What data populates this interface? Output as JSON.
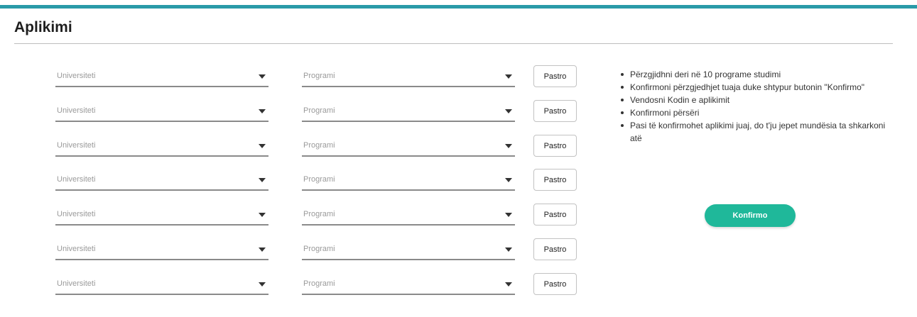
{
  "header": {
    "title": "Aplikimi",
    "accent_color": "#2a9aa8"
  },
  "rows": [
    {
      "university_placeholder": "Universiteti",
      "program_placeholder": "Programi",
      "clear_label": "Pastro"
    },
    {
      "university_placeholder": "Universiteti",
      "program_placeholder": "Programi",
      "clear_label": "Pastro"
    },
    {
      "university_placeholder": "Universiteti",
      "program_placeholder": "Programi",
      "clear_label": "Pastro"
    },
    {
      "university_placeholder": "Universiteti",
      "program_placeholder": "Programi",
      "clear_label": "Pastro"
    },
    {
      "university_placeholder": "Universiteti",
      "program_placeholder": "Programi",
      "clear_label": "Pastro"
    },
    {
      "university_placeholder": "Universiteti",
      "program_placeholder": "Programi",
      "clear_label": "Pastro"
    },
    {
      "university_placeholder": "Universiteti",
      "program_placeholder": "Programi",
      "clear_label": "Pastro"
    }
  ],
  "instructions": [
    "Përzgjidhni deri në 10 programe studimi",
    "Konfirmoni përzgjedhjet tuaja duke shtypur butonin \"Konfirmo\"",
    "Vendosni Kodin e aplikimit",
    "Konfirmoni përsëri",
    "Pasi të konfirmohet aplikimi juaj, do t'ju jepet mundësia ta shkarkoni atë"
  ],
  "confirm": {
    "label": "Konfirmo",
    "color": "#1fb89a"
  },
  "icons": {
    "dropdown": "caret-down-icon",
    "bullet": "bullet-icon"
  }
}
